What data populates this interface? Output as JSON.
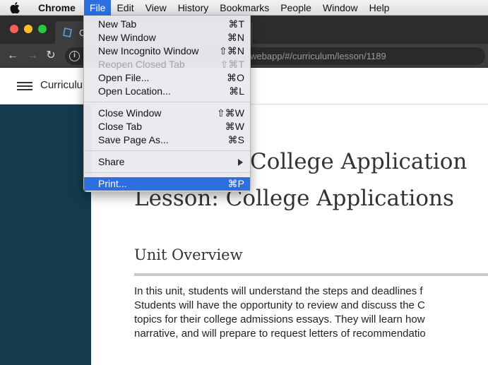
{
  "menubar": {
    "app_name": "Chrome",
    "items": [
      "File",
      "Edit",
      "View",
      "History",
      "Bookmarks",
      "People",
      "Window",
      "Help"
    ],
    "active": "File"
  },
  "tab": {
    "title": "C"
  },
  "toolbar": {
    "url": "webapp/#/curriculum/lesson/1189"
  },
  "header": {
    "brand": "Curriculu"
  },
  "content": {
    "unit_title": "College Application",
    "lesson_title": "Lesson: College Applications",
    "section_heading": "Unit Overview",
    "overview_lines": [
      "In this unit, students will understand the steps and deadlines f",
      "Students will have the opportunity to review and discuss the C",
      "topics for their college admissions essays. They will learn how",
      "narrative, and will prepare to request letters of recommendatio"
    ]
  },
  "file_menu": {
    "groups": [
      [
        {
          "label": "New Tab",
          "shortcut": "⌘T",
          "disabled": false
        },
        {
          "label": "New Window",
          "shortcut": "⌘N",
          "disabled": false
        },
        {
          "label": "New Incognito Window",
          "shortcut": "⇧⌘N",
          "disabled": false
        },
        {
          "label": "Reopen Closed Tab",
          "shortcut": "⇧⌘T",
          "disabled": true
        },
        {
          "label": "Open File...",
          "shortcut": "⌘O",
          "disabled": false
        },
        {
          "label": "Open Location...",
          "shortcut": "⌘L",
          "disabled": false
        }
      ],
      [
        {
          "label": "Close Window",
          "shortcut": "⇧⌘W",
          "disabled": false
        },
        {
          "label": "Close Tab",
          "shortcut": "⌘W",
          "disabled": false
        },
        {
          "label": "Save Page As...",
          "shortcut": "⌘S",
          "disabled": false
        }
      ],
      [
        {
          "label": "Share",
          "submenu": true
        }
      ],
      [
        {
          "label": "Print...",
          "shortcut": "⌘P",
          "highlighted": true
        }
      ]
    ]
  },
  "colors": {
    "menu_highlight": "#2e6fe0",
    "sidebar": "#133a4d",
    "chrome_frame": "#2c2c2c"
  }
}
